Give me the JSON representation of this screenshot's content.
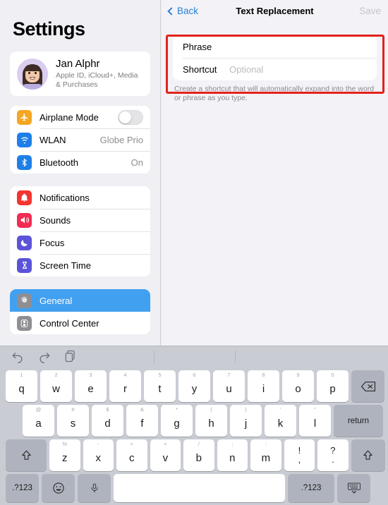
{
  "sidebar": {
    "title": "Settings",
    "profile": {
      "name": "Jan Alphr",
      "subtitle": "Apple ID, iCloud+, Media & Purchases",
      "avatar_icon": "memoji-avatar"
    },
    "group_connectivity": [
      {
        "label": "Airplane Mode",
        "icon": "airplane-icon",
        "icon_color": "#f5a623",
        "value": "",
        "control": "toggle",
        "toggle_on": false
      },
      {
        "label": "WLAN",
        "icon": "wifi-icon",
        "icon_color": "#1f7fe8",
        "value": "Globe Prio",
        "control": "value"
      },
      {
        "label": "Bluetooth",
        "icon": "bluetooth-icon",
        "icon_color": "#1f7fe8",
        "value": "On",
        "control": "value"
      }
    ],
    "group_alerts": [
      {
        "label": "Notifications",
        "icon": "bell-icon",
        "icon_color": "#f3342f"
      },
      {
        "label": "Sounds",
        "icon": "speaker-icon",
        "icon_color": "#f12c53"
      },
      {
        "label": "Focus",
        "icon": "moon-icon",
        "icon_color": "#5b53d8"
      },
      {
        "label": "Screen Time",
        "icon": "hourglass-icon",
        "icon_color": "#5b53d8"
      }
    ],
    "group_system": [
      {
        "label": "General",
        "icon": "gear-icon",
        "icon_color": "#8e8e93",
        "selected": true
      },
      {
        "label": "Control Center",
        "icon": "sliders-icon",
        "icon_color": "#8e8e93",
        "selected": false
      }
    ],
    "selected_accent": "#42a0f0"
  },
  "detail": {
    "back_label": "Back",
    "back_icon": "chevron-left-icon",
    "title": "Text Replacement",
    "save_label": "Save",
    "save_disabled": true,
    "form": {
      "phrase_label": "Phrase",
      "phrase_value": "",
      "phrase_placeholder": "",
      "shortcut_label": "Shortcut",
      "shortcut_value": "",
      "shortcut_placeholder": "Optional"
    },
    "helper_text": "Create a shortcut that will automatically expand into the word or phrase as you type.",
    "highlight_color": "#e2231a"
  },
  "keyboard": {
    "toolbar": [
      {
        "icon": "undo-icon"
      },
      {
        "icon": "redo-icon"
      },
      {
        "icon": "paste-icon"
      }
    ],
    "row1": [
      {
        "main": "q",
        "alt": "1"
      },
      {
        "main": "w",
        "alt": "2"
      },
      {
        "main": "e",
        "alt": "3"
      },
      {
        "main": "r",
        "alt": "4"
      },
      {
        "main": "t",
        "alt": "5"
      },
      {
        "main": "y",
        "alt": "6"
      },
      {
        "main": "u",
        "alt": "7"
      },
      {
        "main": "i",
        "alt": "8"
      },
      {
        "main": "o",
        "alt": "9"
      },
      {
        "main": "p",
        "alt": "0"
      }
    ],
    "row1_delete": {
      "icon": "delete-icon"
    },
    "row2": [
      {
        "main": "a",
        "alt": "@"
      },
      {
        "main": "s",
        "alt": "#"
      },
      {
        "main": "d",
        "alt": "$"
      },
      {
        "main": "f",
        "alt": "&"
      },
      {
        "main": "g",
        "alt": "*"
      },
      {
        "main": "h",
        "alt": "("
      },
      {
        "main": "j",
        "alt": ")"
      },
      {
        "main": "k",
        "alt": "'"
      },
      {
        "main": "l",
        "alt": "\""
      }
    ],
    "row2_return": {
      "label": "return"
    },
    "row3_shift_left": {
      "icon": "shift-icon"
    },
    "row3": [
      {
        "main": "z",
        "alt": "%"
      },
      {
        "main": "x",
        "alt": "-"
      },
      {
        "main": "c",
        "alt": "+"
      },
      {
        "main": "v",
        "alt": "="
      },
      {
        "main": "b",
        "alt": "/"
      },
      {
        "main": "n",
        "alt": ";"
      },
      {
        "main": "m",
        "alt": ":"
      }
    ],
    "row3_punct": [
      {
        "top": "!",
        "bot": ","
      },
      {
        "top": "?",
        "bot": "."
      }
    ],
    "row3_shift_right": {
      "icon": "shift-icon"
    },
    "row4": {
      "numbers_left": ".?123",
      "emoji": {
        "icon": "emoji-icon"
      },
      "mic": {
        "icon": "microphone-icon"
      },
      "space": "",
      "numbers_right": ".?123",
      "dismiss": {
        "icon": "keyboard-dismiss-icon"
      }
    }
  }
}
